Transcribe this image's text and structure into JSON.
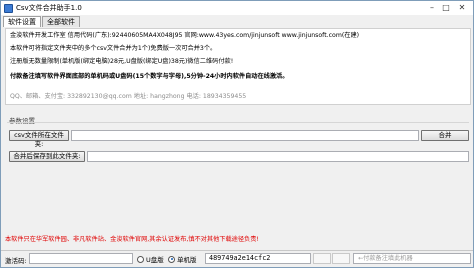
{
  "window": {
    "title": "Csv文件合并助手1.0"
  },
  "tabs": [
    {
      "label": "软件设置"
    },
    {
      "label": "全部软件"
    }
  ],
  "info": {
    "line1": "金浚软件开发工作室  信用代码(广东):92440605MA4X048J95  官网:www.43yes.com/jinjunsoft  www.jinjunsoft.com(在建)",
    "line2": "本软件可将指定文件夹中的多个csv文件合并为1个)免费版一次可合并3个。",
    "line3": "注册版无数量限制(单机版(绑定电脑)28元,U盘版(绑定U盘)38元)微信二维码付款!",
    "line4": "付款备注填写软件界面底部的单机码或U盘码(15个数字与字母),5分钟-24小时内软件自动在线激活。",
    "line5": "QQ、邮箱、支付宝: 332892130@qq.com   地址: hangzhong   电话: 18934359455"
  },
  "params": {
    "group_label": "参数设置",
    "select_folder_button": "csv文件所在文件夹:",
    "source_path": "",
    "merge_button": "合并",
    "save_folder_button": "合并后保存到此文件夹:",
    "save_path": ""
  },
  "notice": "本软件只在华军软件园、非凡软件站、金浚软件官网,其余认证发布,慎不对其他下载途径负责!",
  "statusbar": {
    "reg_label": "激活码:",
    "reg_value": "",
    "radio_u_label": "U盘版",
    "radio_pc_label": "单机版",
    "machine_code": "489749a2e14cfc2",
    "pay_placeholder": "←付款备注填此机器"
  },
  "colors": {
    "notice_red": "#e00000",
    "accent_blue": "#1a5fb4",
    "info_grey": "#8c8c8c"
  }
}
